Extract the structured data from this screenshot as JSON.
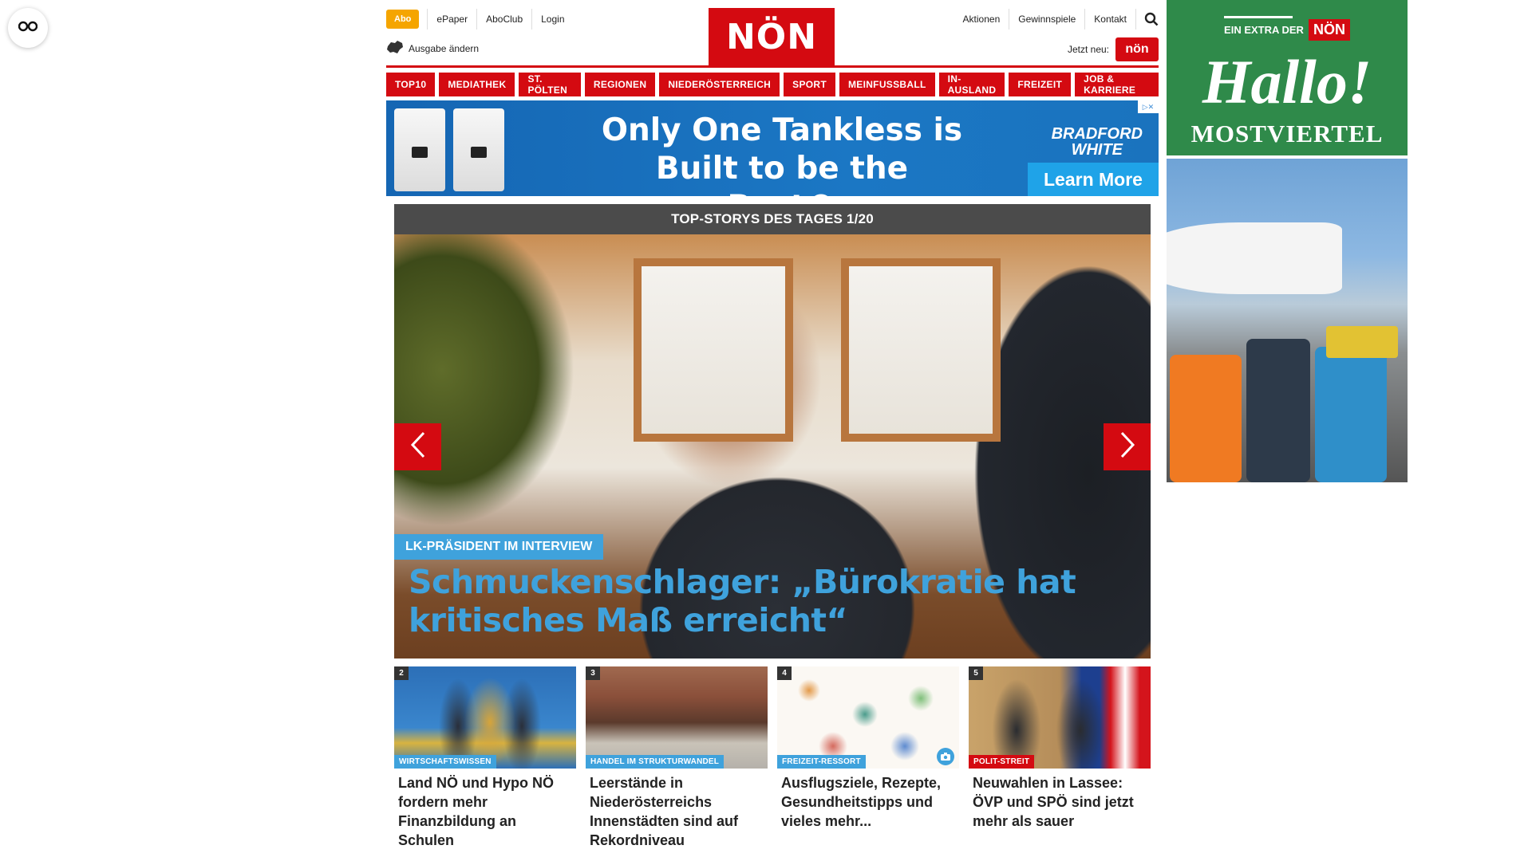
{
  "header": {
    "abo": "Abo",
    "left_links": [
      "ePaper",
      "AboClub",
      "Login"
    ],
    "ausgabe": "Ausgabe ändern",
    "logo": "NÖN",
    "right_links": [
      "Aktionen",
      "Gewinnspiele",
      "Kontakt"
    ],
    "jetzt_neu": "Jetzt neu:",
    "jetzt_badge": "nön"
  },
  "nav": {
    "items": [
      "TOP10",
      "MEDIATHEK",
      "ST. PÖLTEN",
      "REGIONEN",
      "NIEDERÖSTERREICH",
      "SPORT",
      "MEINFUSSBALL",
      "IN-AUSLAND",
      "FREIZEIT",
      "JOB & KARRIERE"
    ]
  },
  "ad_banner": {
    "headline_1": "Only One Tankless is",
    "headline_2": "Built to be the Best®",
    "brand_1": "BRADFORD",
    "brand_2": "WHITE",
    "cta": "Learn More"
  },
  "top_stories": {
    "header": "TOP-STORYS DES TAGES 1/20",
    "hero": {
      "kicker": "LK-PRÄSIDENT IM INTERVIEW",
      "title": "Schmuckenschlager: „Bürokratie hat kritisches Maß erreicht“"
    },
    "cards": [
      {
        "num": "2",
        "tag": "WIRTSCHAFTSWISSEN",
        "title": "Land NÖ und Hypo NÖ fordern mehr Finanzbildung an Schulen"
      },
      {
        "num": "3",
        "tag": "HANDEL IM STRUKTURWANDEL",
        "title": "Leerstände in Niederösterreichs Innenstädten sind auf Rekordniveau"
      },
      {
        "num": "4",
        "tag": "FREIZEIT-RESSORT",
        "title": "Ausflugsziele, Rezepte, Gesundheitstipps und vieles mehr..."
      },
      {
        "num": "5",
        "tag": "POLIT-STREIT",
        "title": "Neuwahlen in Lassee: ÖVP und SPÖ sind jetzt mehr als sauer"
      }
    ]
  },
  "side_ad": {
    "extra": "EIN EXTRA DER",
    "noen": "NÖN",
    "hallo": "Hallo!",
    "region": "MOSTVIERTEL"
  },
  "colors": {
    "brand_red": "#d40a11",
    "accent_blue": "#3fa2dc",
    "abo_orange": "#f5a500",
    "story_header": "#4b4b4b",
    "side_green": "#2f8a4a"
  }
}
